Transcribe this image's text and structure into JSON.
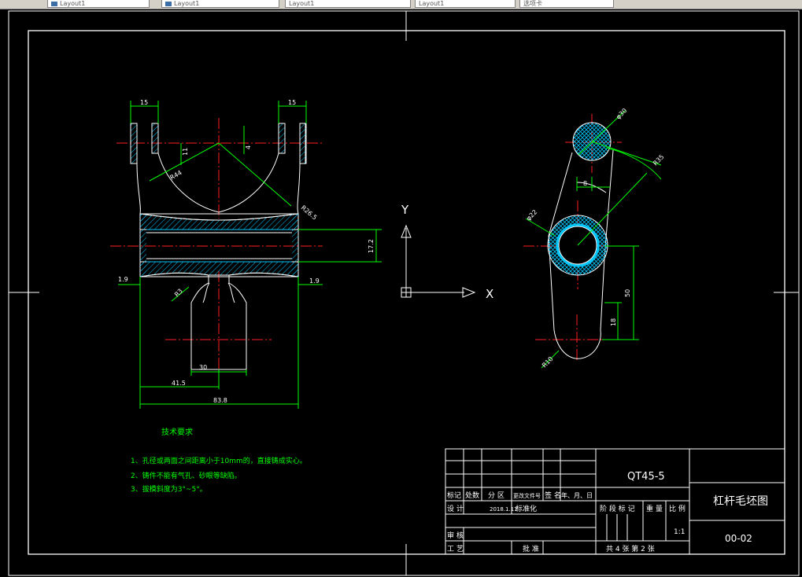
{
  "tabs": [
    {
      "label": "Layout1"
    },
    {
      "label": "Layout1"
    },
    {
      "label": "Layout1"
    },
    {
      "label": "Layout1"
    },
    {
      "label": "选项卡"
    }
  ],
  "dimensions": {
    "top_left_15": "15",
    "top_right_15": "15",
    "r44": "R44",
    "d11": "11",
    "d4": "4",
    "r26": "R26.5",
    "d17": "17.2",
    "left_19": "1.9",
    "right_19": "1.9",
    "r3": "R3",
    "d30": "30",
    "d415": "41.5",
    "d838": "83.8",
    "phi30": "φ30",
    "r35": "R35",
    "d8": "8",
    "phi22": "φ22",
    "d50": "50",
    "d18": "18",
    "r10": "R10"
  },
  "axes": {
    "y": "Y",
    "x": "X"
  },
  "notes": {
    "title": "技术要求",
    "items": [
      "1、孔径或两面之间距离小于10mm的，直接铸成实心。",
      "2、铸件不能有气孔、砂眼等缺陷。",
      "3、拔模斜度为3°~5°。"
    ]
  },
  "titleblock": {
    "material": "QT45-5",
    "name": "杠杆毛坯图",
    "code": "00-02",
    "h_mark": "标记",
    "h_count": "处数",
    "h_zone": "分 区",
    "h_docno": "更改文件号",
    "h_sign": "签 名",
    "h_date": "年、月、日",
    "design": "设 计",
    "design_date": "2018.1.11",
    "standard": "标准化",
    "stage": "阶 段 标 记",
    "weight": "重 量",
    "scale_label": "比 例",
    "scale": "1:1",
    "review": "审 核",
    "process": "工 艺",
    "approve": "批 准",
    "sheets": "共 4 张  第 2 张"
  }
}
